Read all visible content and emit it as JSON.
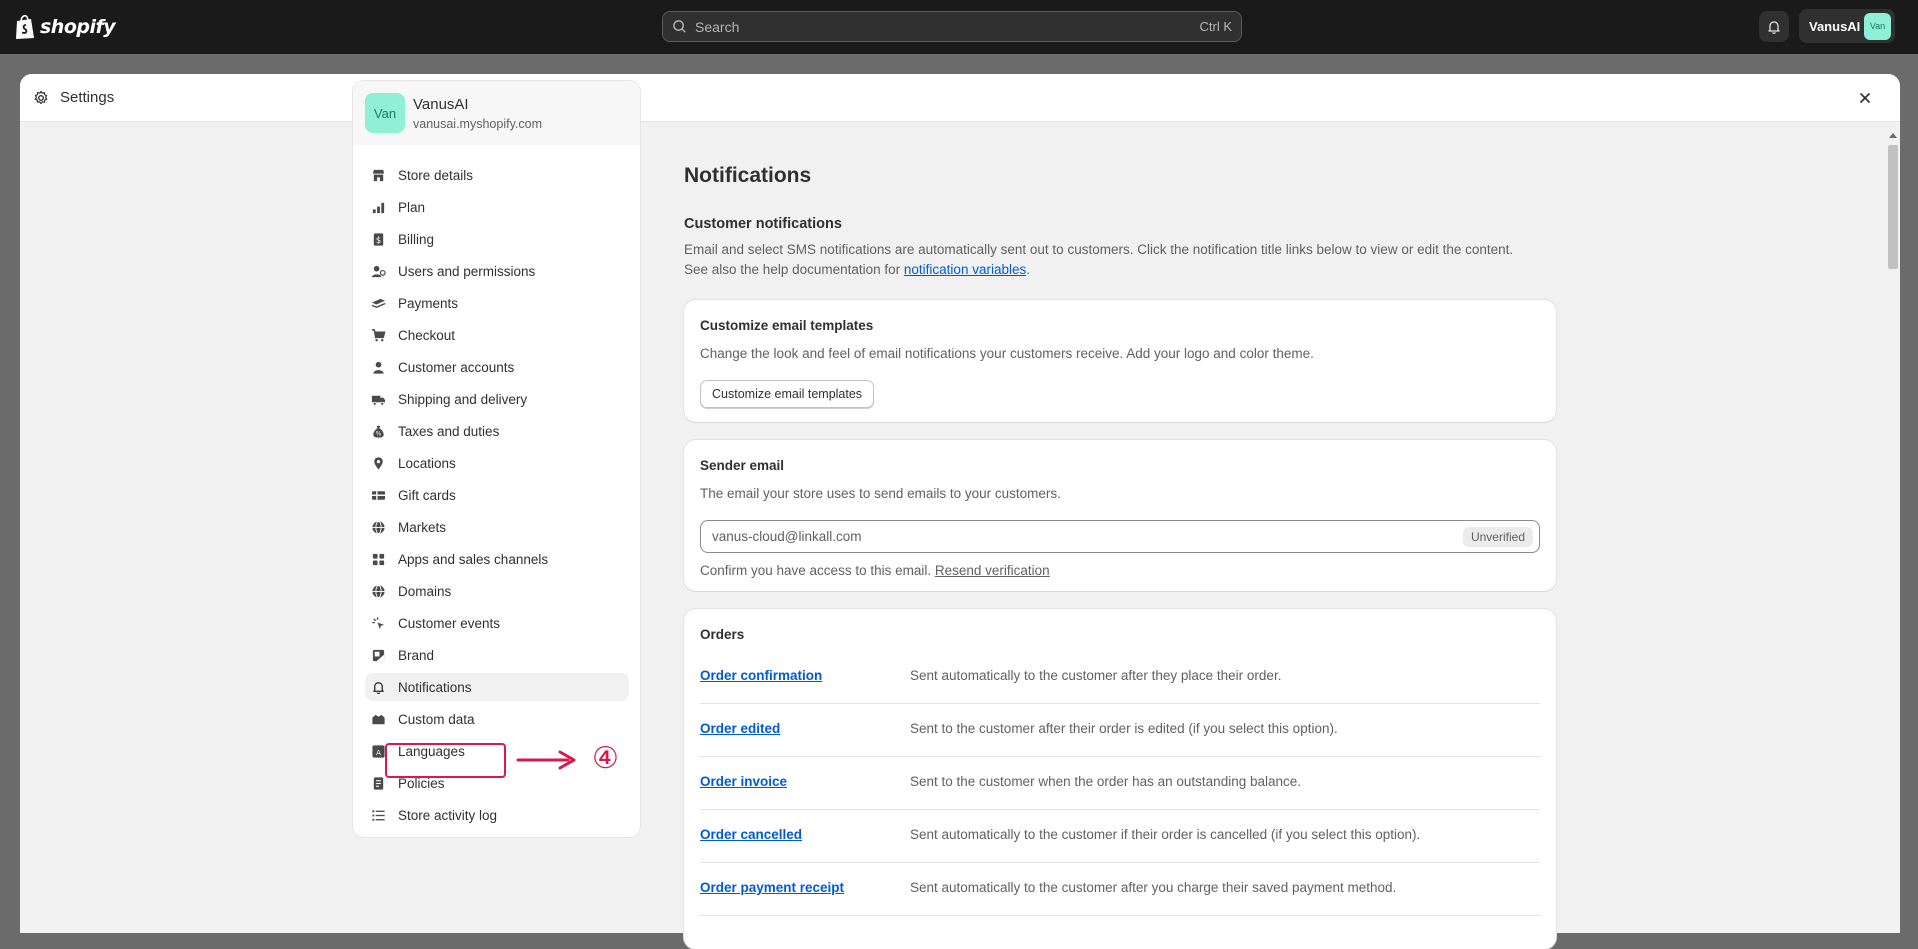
{
  "topbar": {
    "logo_text": "shopify",
    "search_placeholder": "Search",
    "search_shortcut": "Ctrl K",
    "user_name": "VanusAI",
    "user_avatar": "Van",
    "icons": [
      "shopify-bag-icon",
      "search-icon",
      "bell-icon"
    ]
  },
  "modal": {
    "title": "Settings",
    "icons": [
      "gear-icon",
      "close-icon"
    ]
  },
  "store": {
    "avatar": "Van",
    "name": "VanusAI",
    "url": "vanusai.myshopify.com"
  },
  "nav": {
    "items": [
      {
        "label": "Store details",
        "icon": "store-icon"
      },
      {
        "label": "Plan",
        "icon": "plan-icon"
      },
      {
        "label": "Billing",
        "icon": "billing-icon"
      },
      {
        "label": "Users and permissions",
        "icon": "users-icon"
      },
      {
        "label": "Payments",
        "icon": "payments-icon"
      },
      {
        "label": "Checkout",
        "icon": "cart-icon"
      },
      {
        "label": "Customer accounts",
        "icon": "person-icon"
      },
      {
        "label": "Shipping and delivery",
        "icon": "truck-icon"
      },
      {
        "label": "Taxes and duties",
        "icon": "tax-icon"
      },
      {
        "label": "Locations",
        "icon": "location-icon"
      },
      {
        "label": "Gift cards",
        "icon": "gift-card-icon"
      },
      {
        "label": "Markets",
        "icon": "globe-icon"
      },
      {
        "label": "Apps and sales channels",
        "icon": "apps-icon"
      },
      {
        "label": "Domains",
        "icon": "globe-icon"
      },
      {
        "label": "Customer events",
        "icon": "cursor-icon"
      },
      {
        "label": "Brand",
        "icon": "brand-icon"
      },
      {
        "label": "Notifications",
        "icon": "bell-icon"
      },
      {
        "label": "Custom data",
        "icon": "database-icon"
      },
      {
        "label": "Languages",
        "icon": "language-icon"
      },
      {
        "label": "Policies",
        "icon": "policy-icon"
      },
      {
        "label": "Store activity log",
        "icon": "list-icon"
      }
    ],
    "active": "Notifications",
    "annotation_step": "④",
    "annotation_color": "#d41b4b"
  },
  "main": {
    "title": "Notifications",
    "section_title": "Customer notifications",
    "section_desc_1": "Email and select SMS notifications are automatically sent out to customers. Click the notification title links below to view or edit the content. See also the help documentation for ",
    "section_desc_link": "notification variables",
    "section_desc_2": ".",
    "templates_card": {
      "title": "Customize email templates",
      "text": "Change the look and feel of email notifications your customers receive. Add your logo and color theme.",
      "button": "Customize email templates"
    },
    "sender_card": {
      "title": "Sender email",
      "text": "The email your store uses to send emails to your customers.",
      "email": "vanus-cloud@linkall.com",
      "badge": "Unverified",
      "helper": "Confirm you have access to this email. ",
      "helper_link": "Resend verification"
    },
    "orders_card": {
      "title": "Orders",
      "rows": [
        {
          "name": "Order confirmation",
          "desc": "Sent automatically to the customer after they place their order."
        },
        {
          "name": "Order edited",
          "desc": "Sent to the customer after their order is edited (if you select this option)."
        },
        {
          "name": "Order invoice",
          "desc": "Sent to the customer when the order has an outstanding balance."
        },
        {
          "name": "Order cancelled",
          "desc": "Sent automatically to the customer if their order is cancelled (if you select this option)."
        },
        {
          "name": "Order payment receipt",
          "desc": "Sent automatically to the customer after you charge their saved payment method."
        }
      ]
    }
  },
  "colors": {
    "topbar": "#1a1a1a",
    "link": "#005bd3",
    "avatar_bg": "#8ff0d5"
  }
}
